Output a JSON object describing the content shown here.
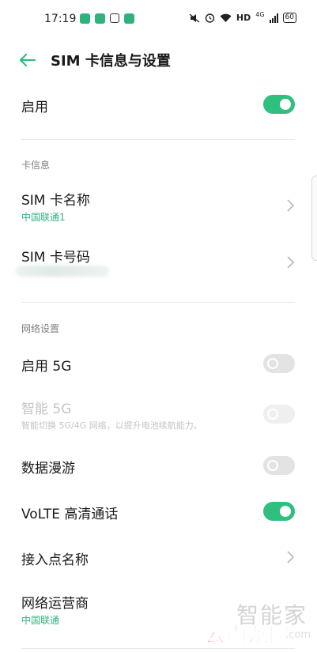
{
  "status_bar": {
    "time": "17:19",
    "network_label": "HD",
    "signal_label": "4G",
    "battery": "60"
  },
  "header": {
    "title": "SIM 卡信息与设置",
    "back_icon": "arrow-left-icon"
  },
  "colors": {
    "accent": "#2fbf7f",
    "accent_text": "#2fb37e",
    "section_label": "#808080",
    "disabled_text": "#c4c4c4",
    "toggle_off": "#e3e3e3",
    "watermark_red": "#e02020"
  },
  "enable": {
    "label": "启用",
    "state": true
  },
  "card_info": {
    "section_label": "卡信息",
    "sim_name": {
      "label": "SIM 卡名称",
      "value": "中国联通1"
    },
    "sim_number": {
      "label": "SIM 卡号码"
    }
  },
  "network": {
    "section_label": "网络设置",
    "enable_5g": {
      "label": "启用 5G",
      "state": false
    },
    "smart_5g": {
      "label": "智能 5G",
      "desc": "智能切换 5G/4G 网络，以提升电池续航能力。",
      "state": false,
      "enabled": false
    },
    "roaming": {
      "label": "数据漫游",
      "state": false
    },
    "volte": {
      "label": "VoLTE 高清通话",
      "state": true
    },
    "apn": {
      "label": "接入点名称"
    },
    "carrier": {
      "label": "网络运营商",
      "value": "中国联通"
    }
  },
  "watermark": {
    "text1": "智能家",
    "text2": "云南龙网",
    "url": ".com"
  }
}
